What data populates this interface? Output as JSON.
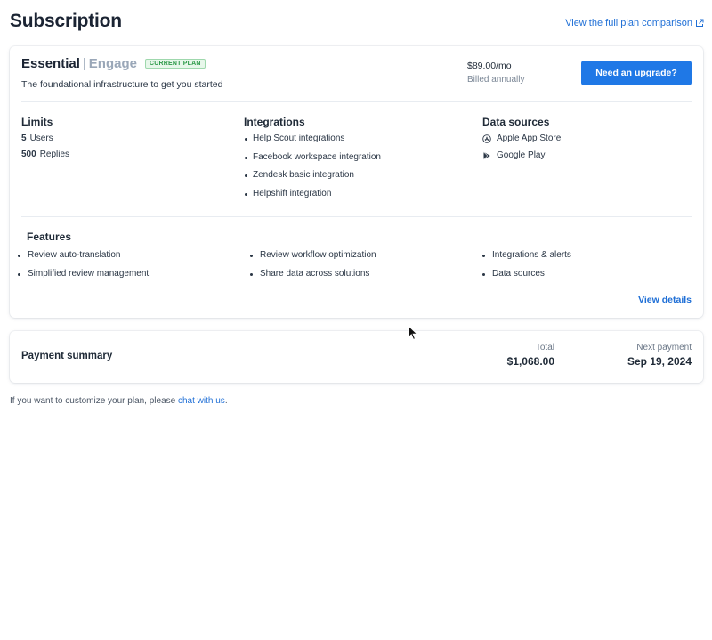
{
  "header": {
    "title": "Subscription",
    "compare_link": "View the full plan comparison"
  },
  "plan": {
    "name": "Essential",
    "separator": "|",
    "product": "Engage",
    "badge": "CURRENT PLAN",
    "description": "The foundational infrastructure to get you started",
    "price": "$89.00/mo",
    "billing": "Billed annually",
    "upgrade_label": "Need an upgrade?",
    "limits": {
      "heading": "Limits",
      "items": [
        {
          "count": "5",
          "label": "Users"
        },
        {
          "count": "500",
          "label": "Replies"
        }
      ]
    },
    "integrations": {
      "heading": "Integrations",
      "items": [
        "Help Scout integrations",
        "Facebook workspace integration",
        "Zendesk basic integration",
        "Helpshift integration"
      ]
    },
    "data_sources": {
      "heading": "Data sources",
      "items": [
        {
          "label": "Apple App Store",
          "icon": "app-store-icon"
        },
        {
          "label": "Google Play",
          "icon": "google-play-icon"
        }
      ]
    },
    "features": {
      "heading": "Features",
      "columns": [
        [
          "Review auto-translation",
          "Simplified review management"
        ],
        [
          "Review workflow optimization",
          "Share data across solutions"
        ],
        [
          "Integrations & alerts",
          "Data sources"
        ]
      ]
    },
    "view_details": "View details"
  },
  "payment": {
    "title": "Payment summary",
    "total_label": "Total",
    "total_value": "$1,068.00",
    "next_label": "Next payment",
    "next_value": "Sep 19, 2024"
  },
  "footer": {
    "prefix": "If you want to customize your plan, please ",
    "link": "chat with us",
    "suffix": "."
  },
  "colors": {
    "accent": "#1f78e6",
    "link": "#1f6fd6",
    "badge_green": "#2f9a4a"
  }
}
